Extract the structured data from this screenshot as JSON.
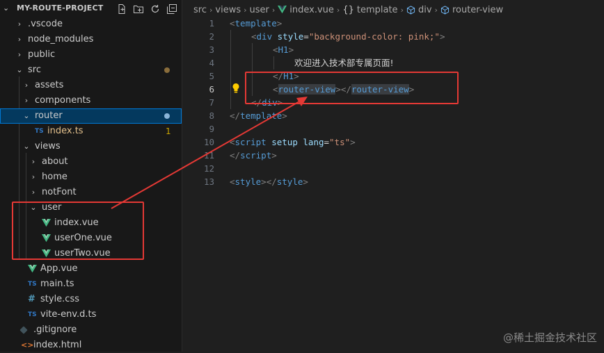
{
  "explorer": {
    "project_title": "MY-ROUTE-PROJECT",
    "actions": [
      {
        "name": "new-file-icon",
        "symbol": "+"
      },
      {
        "name": "new-folder-icon",
        "symbol": "+"
      },
      {
        "name": "refresh-icon",
        "symbol": "↻"
      },
      {
        "name": "collapse-all-icon",
        "symbol": "⧉"
      }
    ],
    "items": [
      {
        "label": ".vscode",
        "kind": "folder-collapsed",
        "depth": 0
      },
      {
        "label": "node_modules",
        "kind": "folder-collapsed",
        "depth": 0
      },
      {
        "label": "public",
        "kind": "folder-collapsed",
        "depth": 0
      },
      {
        "label": "src",
        "kind": "folder-open",
        "depth": 0,
        "modified": true
      },
      {
        "label": "assets",
        "kind": "folder-collapsed",
        "depth": 1
      },
      {
        "label": "components",
        "kind": "folder-collapsed",
        "depth": 1
      },
      {
        "label": "router",
        "kind": "folder-open",
        "depth": 1,
        "modified": true,
        "selected": true
      },
      {
        "label": "index.ts",
        "kind": "ts",
        "depth": 2,
        "modified": true,
        "badge": "1"
      },
      {
        "label": "views",
        "kind": "folder-open",
        "depth": 1
      },
      {
        "label": "about",
        "kind": "folder-collapsed",
        "depth": 2
      },
      {
        "label": "home",
        "kind": "folder-collapsed",
        "depth": 2
      },
      {
        "label": "notFont",
        "kind": "folder-collapsed",
        "depth": 2
      },
      {
        "label": "user",
        "kind": "folder-open",
        "depth": 2
      },
      {
        "label": "index.vue",
        "kind": "vue",
        "depth": 3
      },
      {
        "label": "userOne.vue",
        "kind": "vue",
        "depth": 3
      },
      {
        "label": "userTwo.vue",
        "kind": "vue",
        "depth": 3
      },
      {
        "label": "App.vue",
        "kind": "vue",
        "depth": 1
      },
      {
        "label": "main.ts",
        "kind": "ts",
        "depth": 1
      },
      {
        "label": "style.css",
        "kind": "css",
        "depth": 1
      },
      {
        "label": "vite-env.d.ts",
        "kind": "ts",
        "depth": 1
      },
      {
        "label": ".gitignore",
        "kind": "git",
        "depth": 0
      },
      {
        "label": "index.html",
        "kind": "html",
        "depth": 0
      }
    ]
  },
  "breadcrumb": {
    "parts": [
      "src",
      "views",
      "user",
      "index.vue",
      "template",
      "div",
      "router-view"
    ]
  },
  "editor": {
    "current_line": 6,
    "lines": [
      {
        "num": "1",
        "tokens": [
          [
            "punc",
            "<"
          ],
          [
            "tag",
            "template"
          ],
          [
            "punc",
            ">"
          ]
        ],
        "indent": 0
      },
      {
        "num": "2",
        "tokens": [
          [
            "punc",
            "<"
          ],
          [
            "tag",
            "div"
          ],
          [
            "txt",
            " "
          ],
          [
            "attr",
            "style"
          ],
          [
            "txt",
            "="
          ],
          [
            "str",
            "\"background-color: pink;\""
          ],
          [
            "punc",
            ">"
          ]
        ],
        "indent": 1
      },
      {
        "num": "3",
        "tokens": [
          [
            "punc",
            "<"
          ],
          [
            "tag",
            "H1"
          ],
          [
            "punc",
            ">"
          ]
        ],
        "indent": 2
      },
      {
        "num": "4",
        "tokens": [
          [
            "txt-cjk",
            "欢迎进入技术部专属页面!"
          ]
        ],
        "indent": 3
      },
      {
        "num": "5",
        "tokens": [
          [
            "punc",
            "</"
          ],
          [
            "tag",
            "H1"
          ],
          [
            "punc",
            ">"
          ]
        ],
        "indent": 2
      },
      {
        "num": "6",
        "tokens": [
          [
            "punc",
            "<"
          ],
          [
            "tag hl",
            "router-view"
          ],
          [
            "punc",
            "></"
          ],
          [
            "tag hl",
            "router-view"
          ],
          [
            "punc",
            ">"
          ]
        ],
        "indent": 2
      },
      {
        "num": "7",
        "tokens": [
          [
            "punc",
            "</"
          ],
          [
            "tag",
            "div"
          ],
          [
            "punc",
            ">"
          ]
        ],
        "indent": 1
      },
      {
        "num": "8",
        "tokens": [
          [
            "punc",
            "</"
          ],
          [
            "tag",
            "template"
          ],
          [
            "punc",
            ">"
          ]
        ],
        "indent": 0
      },
      {
        "num": "9",
        "tokens": [],
        "indent": 0
      },
      {
        "num": "10",
        "tokens": [
          [
            "punc",
            "<"
          ],
          [
            "tag",
            "script"
          ],
          [
            "txt",
            " "
          ],
          [
            "attr",
            "setup"
          ],
          [
            "txt",
            " "
          ],
          [
            "attr",
            "lang"
          ],
          [
            "txt",
            "="
          ],
          [
            "str",
            "\"ts\""
          ],
          [
            "punc",
            ">"
          ]
        ],
        "indent": 0
      },
      {
        "num": "11",
        "tokens": [
          [
            "punc",
            "</"
          ],
          [
            "tag",
            "script"
          ],
          [
            "punc",
            ">"
          ]
        ],
        "indent": 0
      },
      {
        "num": "12",
        "tokens": [],
        "indent": 0
      },
      {
        "num": "13",
        "tokens": [
          [
            "punc",
            "<"
          ],
          [
            "tag",
            "style"
          ],
          [
            "punc",
            "></"
          ],
          [
            "tag",
            "style"
          ],
          [
            "punc",
            ">"
          ]
        ],
        "indent": 0
      }
    ]
  },
  "watermark": "@稀土掘金技术社区",
  "colors": {
    "annotation_red": "#e53935",
    "vue_green": "#41b883",
    "ts_blue": "#3178c6",
    "selection": "#04395e"
  }
}
